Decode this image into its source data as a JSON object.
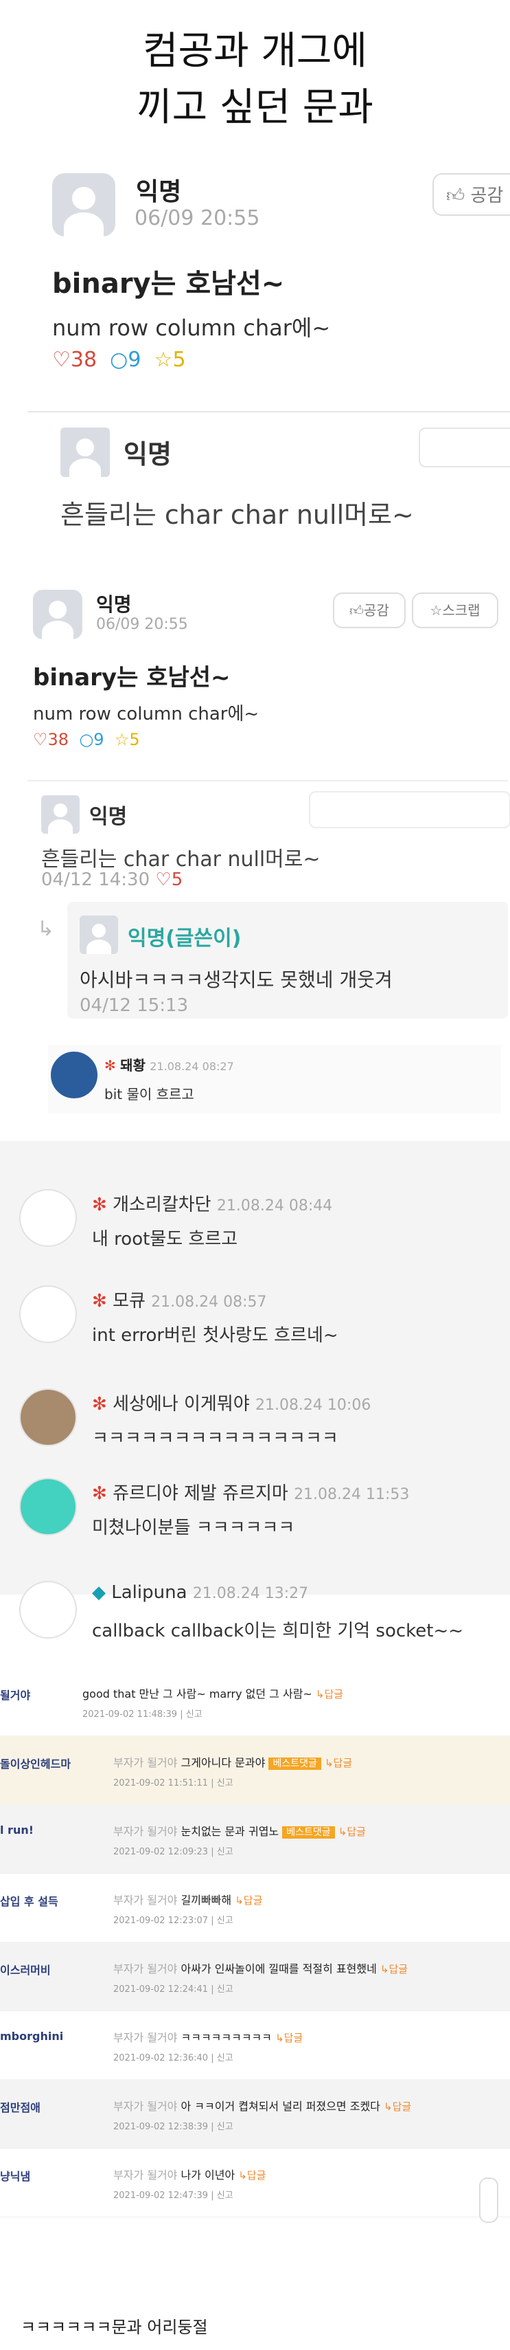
{
  "title_line1": "컴공과 개그에",
  "title_line2": "끼고 싶던 문과",
  "post1": {
    "author": "익명",
    "date": "06/09 20:55",
    "empathy": "공감",
    "headline": "binary는 호남선~",
    "body": "num row column char에~",
    "likes": "38",
    "comments": "9",
    "stars": "5"
  },
  "cmt1": {
    "author": "익명",
    "text": "흔들리는 char char null머로~"
  },
  "post2": {
    "author": "익명",
    "date": "06/09 20:55",
    "empathy": "공감",
    "scrap": "스크랩",
    "headline": "binary는 호남선~",
    "body": "num row column char에~",
    "likes": "38",
    "comments": "9",
    "stars": "5"
  },
  "cmt2": {
    "author": "익명",
    "text": "흔들리는 char char null머로~",
    "date": "04/12 14:30",
    "likes": "5"
  },
  "reply1": {
    "author": "익명(글쓴이)",
    "text": "아시바ㅋㅋㅋㅋ생각지도 못했네 개웃겨",
    "date": "04/12 15:13"
  },
  "dc1": {
    "nick": "돼황",
    "date": "21.08.24 08:27",
    "text": "bit 물이 흐르고"
  },
  "dc": [
    {
      "nick": "개소리칼차단",
      "date": "21.08.24 08:44",
      "text": "내 root물도 흐르고"
    },
    {
      "nick": "모큐",
      "date": "21.08.24 08:57",
      "text": "int error버린 첫사랑도 흐르네~"
    },
    {
      "nick": "세상에나 이게뭐야",
      "date": "21.08.24 10:06",
      "text": "ㅋㅋㅋㅋㅋㅋㅋㅋㅋㅋㅋㅋㅋㅋㅋ"
    },
    {
      "nick": "쥬르디야 제발 쥬르지마",
      "date": "21.08.24 11:53",
      "text": "미쳤나이분들 ㅋㅋㅋㅋㅋㅋ"
    },
    {
      "nick": "Lalipuna",
      "date": "21.08.24 13:27",
      "text": "callback callback이는 희미한 기억 socket~~"
    }
  ],
  "tbl_reply": "답글",
  "tbl_report": "신고",
  "tbl_best": "베스트댓글",
  "tbl_prefix": "부자가 될거야",
  "tbl": [
    {
      "nick": "될거야",
      "text": "good that 만난 그 사람~ marry 없던 그 사람~",
      "date": "2021-09-02 11:48:39"
    },
    {
      "nick": "돌이상인헤드마",
      "text": "그게아니다 문과야",
      "date": "2021-09-02 11:51:11"
    },
    {
      "nick": "l run!",
      "text": "눈치없는 문과 귀엽노",
      "date": "2021-09-02 12:09:23"
    },
    {
      "nick": "삽입 후 설득",
      "text": "길끼빠빠해",
      "date": "2021-09-02 12:23:07"
    },
    {
      "nick": "이스러머비",
      "text": "아싸가 인싸놀이에 낄때를 적절히 표현했네",
      "date": "2021-09-02 12:24:41"
    },
    {
      "nick": "mborghini",
      "text": "ㅋㅋㅋㅋㅋㅋㅋㅋㅋ",
      "date": "2021-09-02 12:36:40"
    },
    {
      "nick": "점만점애",
      "text": "아 ㅋㅋ이거 켭쳐되서 널리 퍼졌으면 조켔다",
      "date": "2021-09-02 12:38:39"
    },
    {
      "nick": "냥닉냄",
      "text": "나가 이년아",
      "date": "2021-09-02 12:47:39"
    }
  ],
  "footer": "ㅋㅋㅋㅋㅋㅋ문과 어리둥절"
}
